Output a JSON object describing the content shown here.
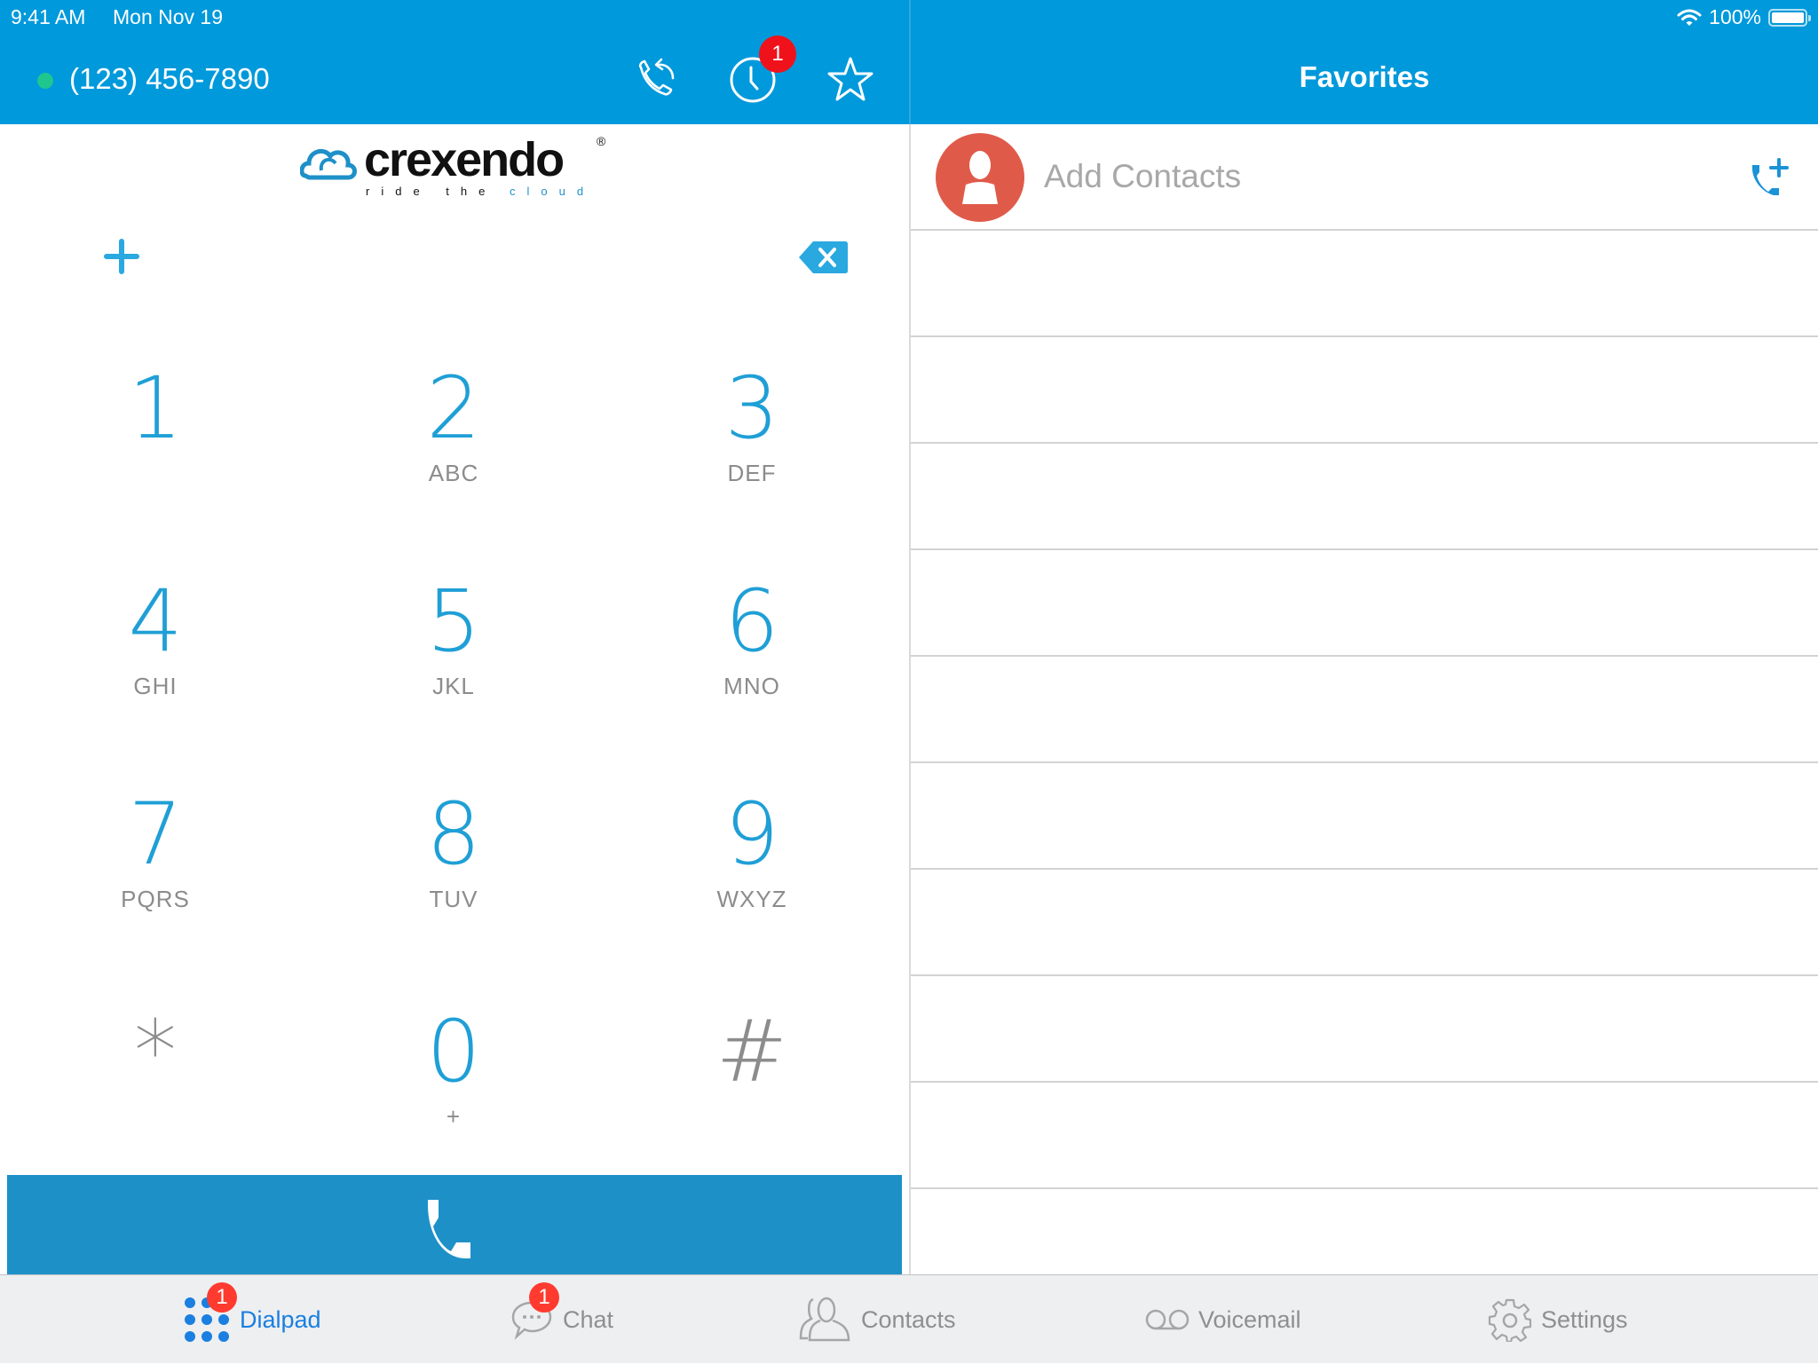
{
  "status_bar": {
    "time": "9:41 AM",
    "date": "Mon Nov 19",
    "battery_percent": "100%",
    "battery_level": 1.0
  },
  "header": {
    "phone_number": "(123) 456-7890",
    "online_status": "online",
    "online_color": "#1fc68e",
    "icons": [
      "call-forward-icon",
      "recent-calls-icon",
      "favorites-star-icon"
    ],
    "recent_badge": "1"
  },
  "logo": {
    "brand": "crexendo",
    "tagline_part1": "ride the",
    "tagline_part2": "cloud",
    "registered": "®"
  },
  "dialpad": {
    "keys": [
      {
        "digit": "1",
        "letters": ""
      },
      {
        "digit": "2",
        "letters": "ABC"
      },
      {
        "digit": "3",
        "letters": "DEF"
      },
      {
        "digit": "4",
        "letters": "GHI"
      },
      {
        "digit": "5",
        "letters": "JKL"
      },
      {
        "digit": "6",
        "letters": "MNO"
      },
      {
        "digit": "7",
        "letters": "PQRS"
      },
      {
        "digit": "8",
        "letters": "TUV"
      },
      {
        "digit": "9",
        "letters": "WXYZ"
      },
      {
        "digit": "*",
        "letters": ""
      },
      {
        "digit": "0",
        "letters": "+"
      },
      {
        "digit": "#",
        "letters": ""
      }
    ],
    "number_input": ""
  },
  "favorites": {
    "title": "Favorites",
    "add_contacts_label": "Add Contacts",
    "empty_rows": 10
  },
  "tabs": [
    {
      "label": "Dialpad",
      "icon": "dialpad-icon",
      "active": true,
      "badge": "1"
    },
    {
      "label": "Chat",
      "icon": "chat-bubble-icon",
      "active": false,
      "badge": "1"
    },
    {
      "label": "Contacts",
      "icon": "contacts-icon",
      "active": false,
      "badge": null
    },
    {
      "label": "Voicemail",
      "icon": "voicemail-icon",
      "active": false,
      "badge": null
    },
    {
      "label": "Settings",
      "icon": "gear-icon",
      "active": false,
      "badge": null
    }
  ],
  "colors": {
    "header_blue": "#0099db",
    "accent_blue": "#1f9fd6",
    "call_bar": "#1e90c8",
    "badge_red": "#ff3b30",
    "avatar_red": "#e05a4a",
    "tab_active": "#1a7fe0"
  }
}
